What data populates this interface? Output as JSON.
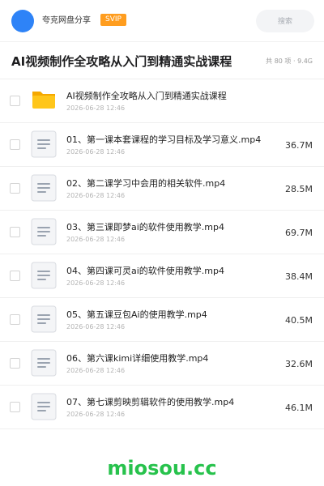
{
  "header": {
    "app_name": "夸克网盘分享",
    "badge": "SVIP",
    "search_label": "搜索"
  },
  "page": {
    "title": "AI视频制作全攻略从入门到精通实战课程",
    "meta": "共 80 项 · 9.4G"
  },
  "colors": {
    "accent": "#2e83f7",
    "badge": "#ff9d1f",
    "folder": "#ffc61a",
    "watermark": "#27c24c"
  },
  "files": [
    {
      "name": "AI视频制作全攻略从入门到精通实战课程",
      "date": "2026-06-28 12:46",
      "size": "",
      "icon": "folder-icon"
    },
    {
      "name": "01、第一课本套课程的学习目标及学习意义.mp4",
      "date": "2026-06-28 12:46",
      "size": "36.7M",
      "icon": "file-icon"
    },
    {
      "name": "02、第二课学习中会用的相关软件.mp4",
      "date": "2026-06-28 12:46",
      "size": "28.5M",
      "icon": "file-icon"
    },
    {
      "name": "03、第三课即梦ai的软件使用教学.mp4",
      "date": "2026-06-28 12:46",
      "size": "69.7M",
      "icon": "file-icon"
    },
    {
      "name": "04、第四课可灵ai的软件使用教学.mp4",
      "date": "2026-06-28 12:46",
      "size": "38.4M",
      "icon": "file-icon"
    },
    {
      "name": "05、第五课豆包Ai的使用教学.mp4",
      "date": "2026-06-28 12:46",
      "size": "40.5M",
      "icon": "file-icon"
    },
    {
      "name": "06、第六课kimi详细使用教学.mp4",
      "date": "2026-06-28 12:46",
      "size": "32.6M",
      "icon": "file-icon"
    },
    {
      "name": "07、第七课剪映剪辑软件的使用教学.mp4",
      "date": "2026-06-28 12:46",
      "size": "46.1M",
      "icon": "file-icon"
    }
  ],
  "watermark": "miosou.cc"
}
